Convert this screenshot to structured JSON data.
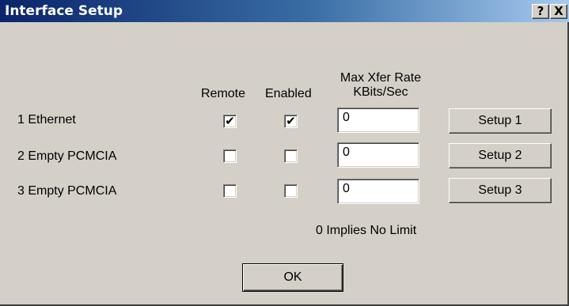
{
  "window": {
    "title": "Interface Setup",
    "help_glyph": "?",
    "close_glyph": "X"
  },
  "headers": {
    "remote": "Remote",
    "enabled": "Enabled",
    "rate_line1": "Max Xfer Rate",
    "rate_line2": "KBits/Sec"
  },
  "interfaces": [
    {
      "label": "1  Ethernet",
      "remote": true,
      "enabled": true,
      "rate": "0",
      "setup_label": "Setup 1"
    },
    {
      "label": "2  Empty PCMCIA",
      "remote": false,
      "enabled": false,
      "rate": "0",
      "setup_label": "Setup 2"
    },
    {
      "label": "3  Empty PCMCIA",
      "remote": false,
      "enabled": false,
      "rate": "0",
      "setup_label": "Setup 3"
    }
  ],
  "check_glyph": "✔",
  "note": "0 Implies No Limit",
  "ok_label": "OK",
  "colors": {
    "title_gradient_start": "#0a246a",
    "title_gradient_end": "#a6caf0",
    "face": "#d4d0c8"
  }
}
